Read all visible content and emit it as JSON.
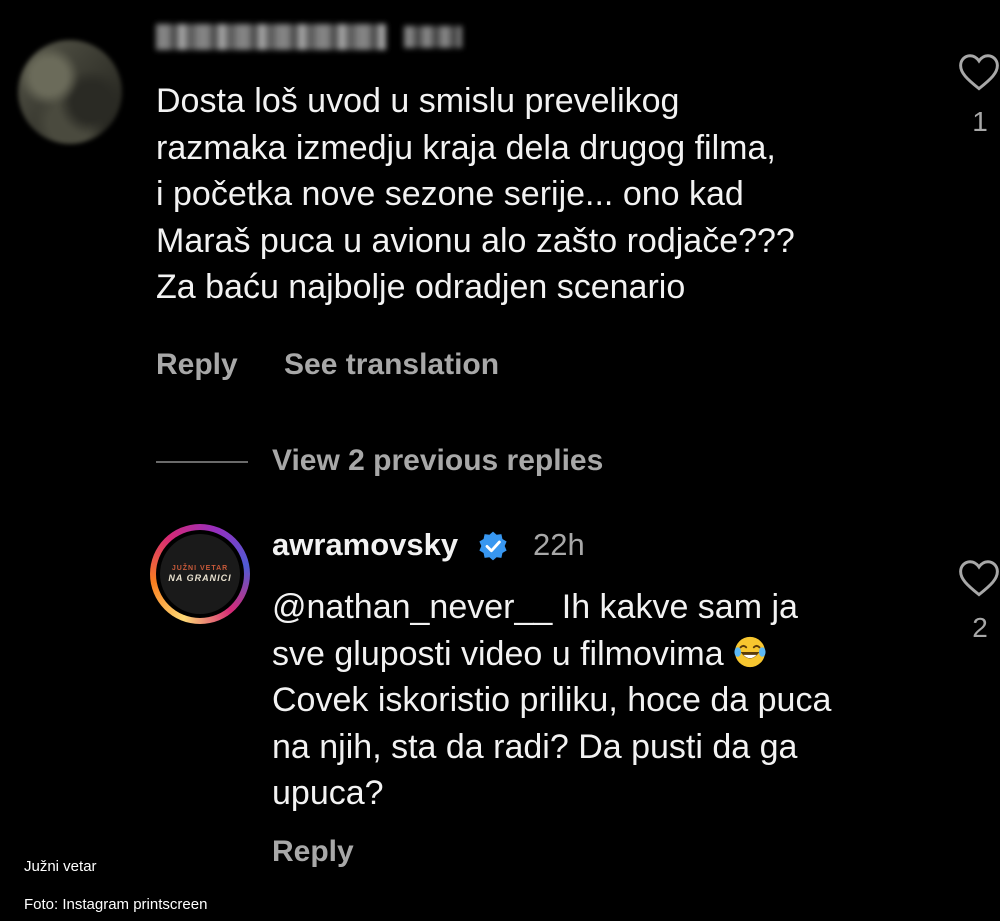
{
  "comment": {
    "username": "nathan_never__",
    "lines": [
      "Dosta loš uvod u smislu prevelikog",
      "razmaka izmedju kraja dela drugog filma,",
      "i početka nove sezone serije... ono kad",
      "Maraš puca u avionu alo zašto rodjače???",
      "Za baću najbolje odradjen scenario"
    ],
    "likes": "1",
    "reply_label": "Reply",
    "translate_label": "See translation"
  },
  "view_replies": "View 2 previous replies",
  "reply": {
    "username": "awramovsky",
    "time": "22h",
    "mention": "@nathan_never__",
    "lines": [
      " Ih kakve sam ja",
      "sve gluposti video u filmovima",
      "Covek iskoristio priliku, hoce da puca",
      "na njih, sta da radi? Da pusti da ga",
      "upuca?"
    ],
    "likes": "2",
    "reply_label": "Reply",
    "logo_top": "JUŽNI VETAR",
    "logo_bottom": "NA GRANICI"
  },
  "caption": {
    "line1": "Južni vetar",
    "line2": "Foto: Instagram printscreen"
  },
  "colors": {
    "background": "#000000",
    "text": "#f2f2f2",
    "muted": "#a8a8a8",
    "verified": "#3897f0"
  },
  "icons": [
    "heart-icon",
    "verified-badge-icon",
    "laughing-emoji-icon"
  ]
}
